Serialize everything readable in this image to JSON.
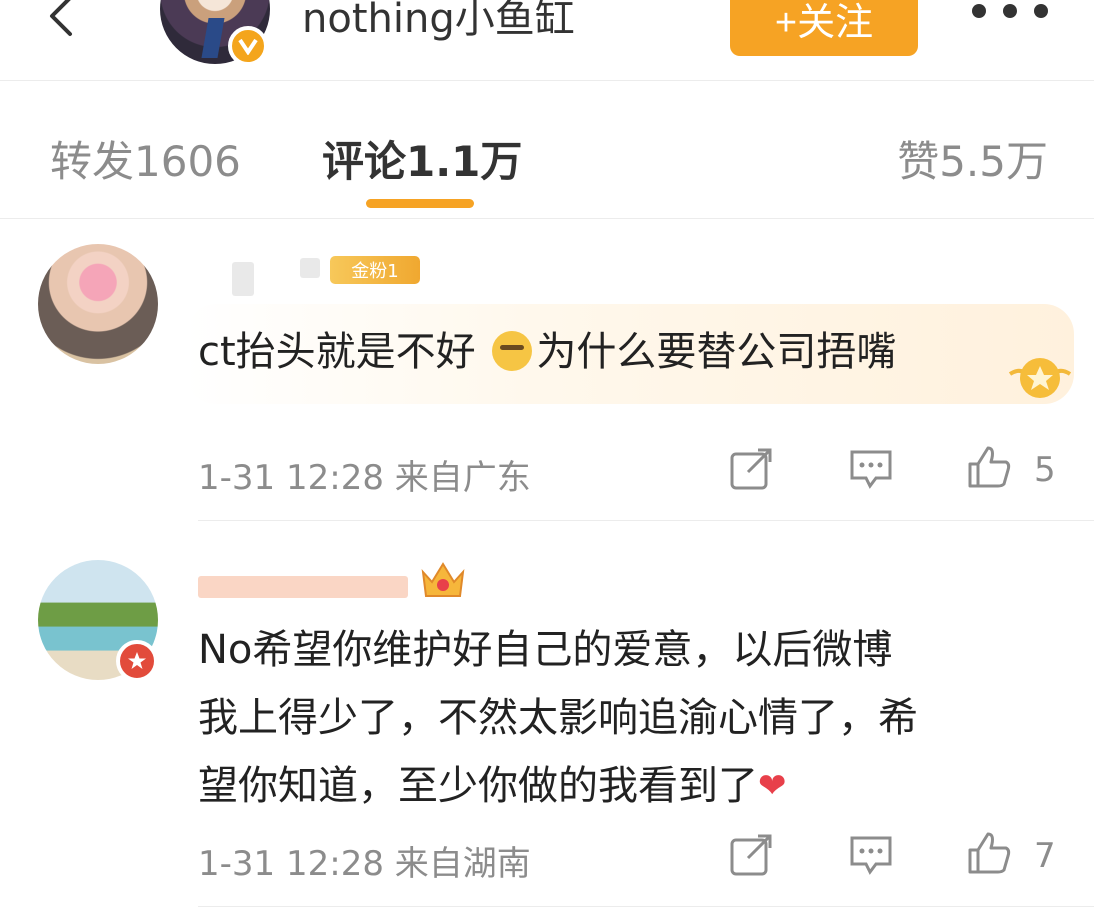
{
  "header": {
    "author_name": "nothing小鱼缸",
    "follow_label": "+关注"
  },
  "tabs": {
    "repost": "转发1606",
    "comment": "评论1.1万",
    "like": "赞5.5万"
  },
  "comments": [
    {
      "fan_badge": "金粉1",
      "text_before_emoji": "ct抬头就是不好 ",
      "text_after_emoji": "为什么要替公司捂嘴",
      "time": "1-31 12:28",
      "location": "来自广东",
      "likes": "5"
    },
    {
      "text_lines": [
        "No希望你维护好自己的爱意，以后微博",
        "我上得少了，不然太影响追渝心情了，希",
        "望你知道，至少你做的我看到了"
      ],
      "time": "1-31 12:28",
      "location": "来自湖南",
      "likes": "7"
    }
  ],
  "colors": {
    "accent": "#f6a324",
    "text": "#222222",
    "muted": "#8c8c8c"
  },
  "icons": [
    "back-icon",
    "more-icon",
    "verified-icon",
    "share-icon",
    "comment-icon",
    "like-icon",
    "crown-icon",
    "emoji-icon",
    "heart-icon"
  ]
}
